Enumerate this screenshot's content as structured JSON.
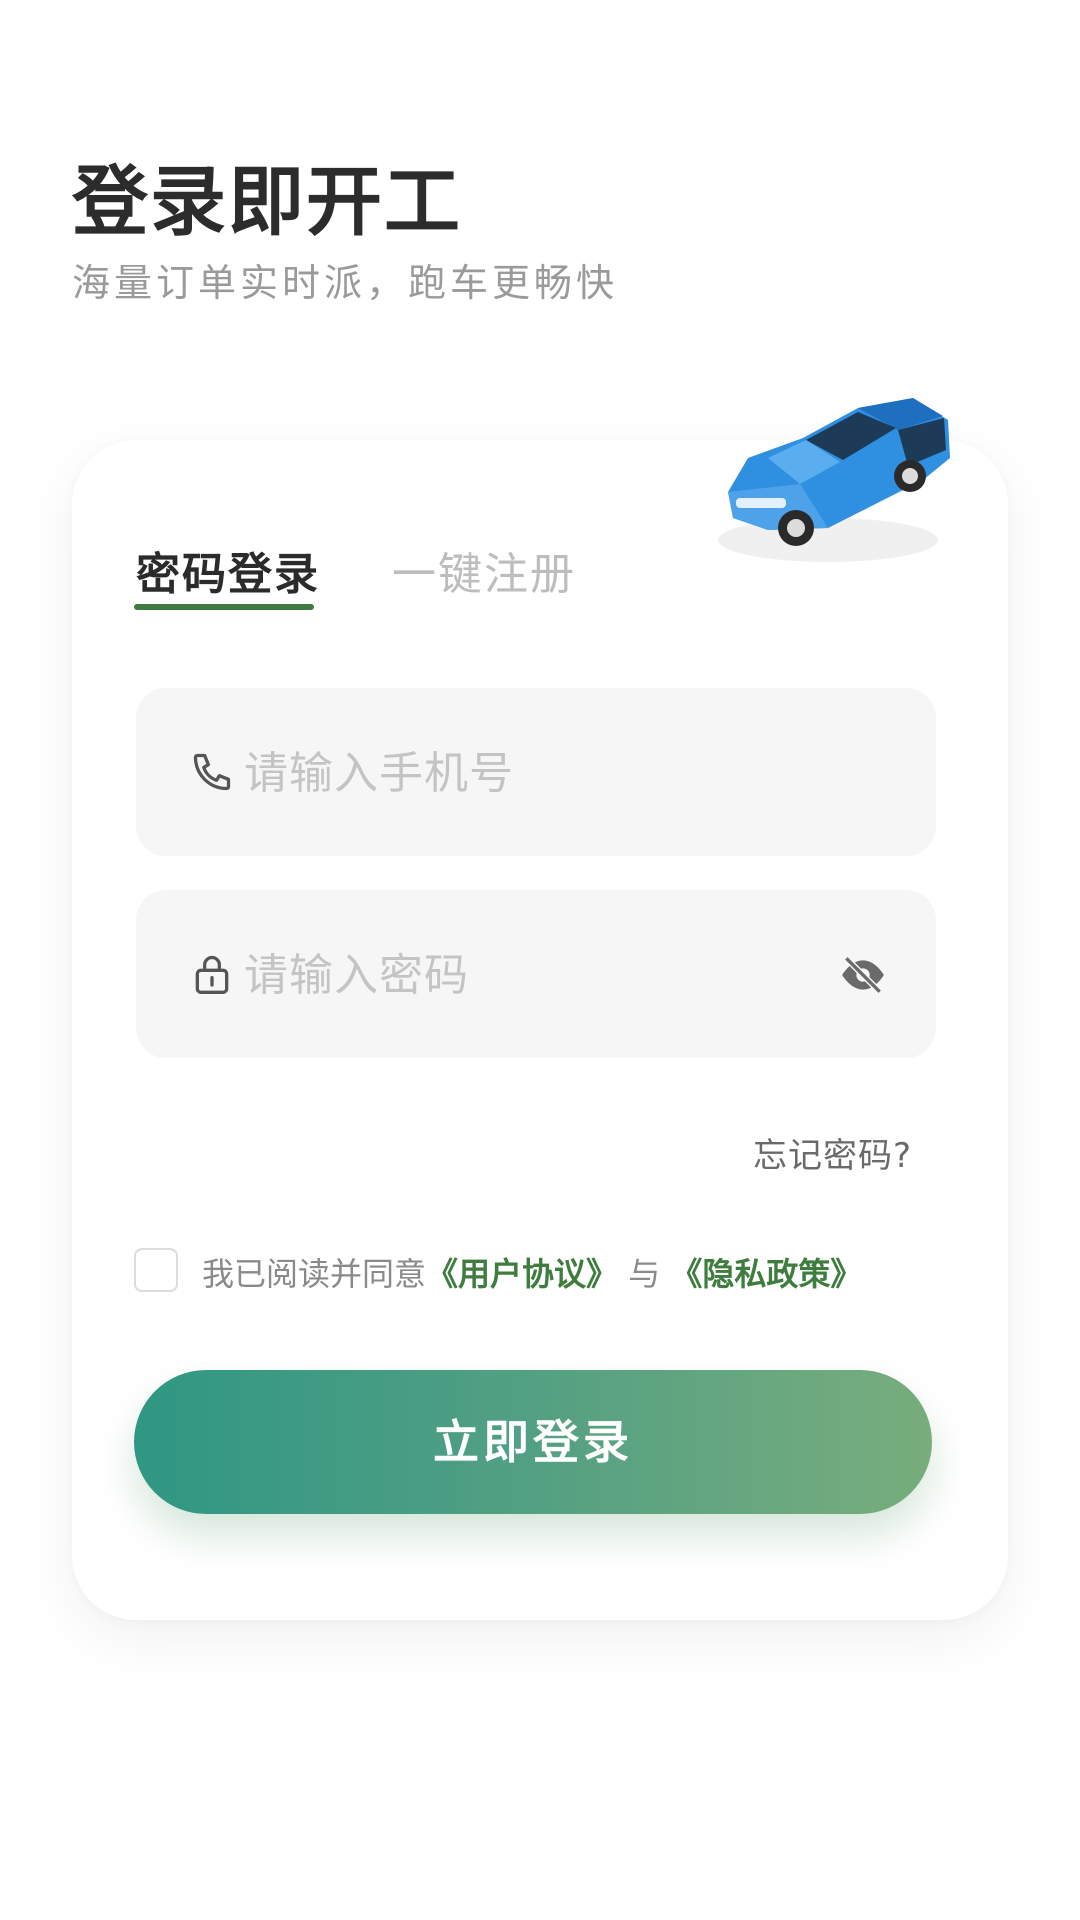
{
  "header": {
    "title": "登录即开工",
    "subtitle": "海量订单实时派，跑车更畅快"
  },
  "tabs": [
    {
      "label": "密码登录",
      "active": true
    },
    {
      "label": "一键注册",
      "active": false
    }
  ],
  "form": {
    "phone": {
      "value": "",
      "placeholder": "请输入手机号",
      "icon": "phone-icon"
    },
    "password": {
      "value": "",
      "placeholder": "请输入密码",
      "icon": "lock-icon",
      "toggle_icon": "eye-off-icon"
    },
    "forgot_label": "忘记密码?"
  },
  "agreement": {
    "checked": false,
    "prefix": "我已阅读并同意",
    "user_agreement": "《用户协议》",
    "connector": "与",
    "privacy_policy": "《隐私政策》"
  },
  "login_button": {
    "label": "立即登录"
  },
  "colors": {
    "accent": "#3f7a42",
    "link": "#3e7d3e",
    "button_start": "#2f9783",
    "button_end": "#78ad7c",
    "car_body": "#2f8fe0"
  }
}
